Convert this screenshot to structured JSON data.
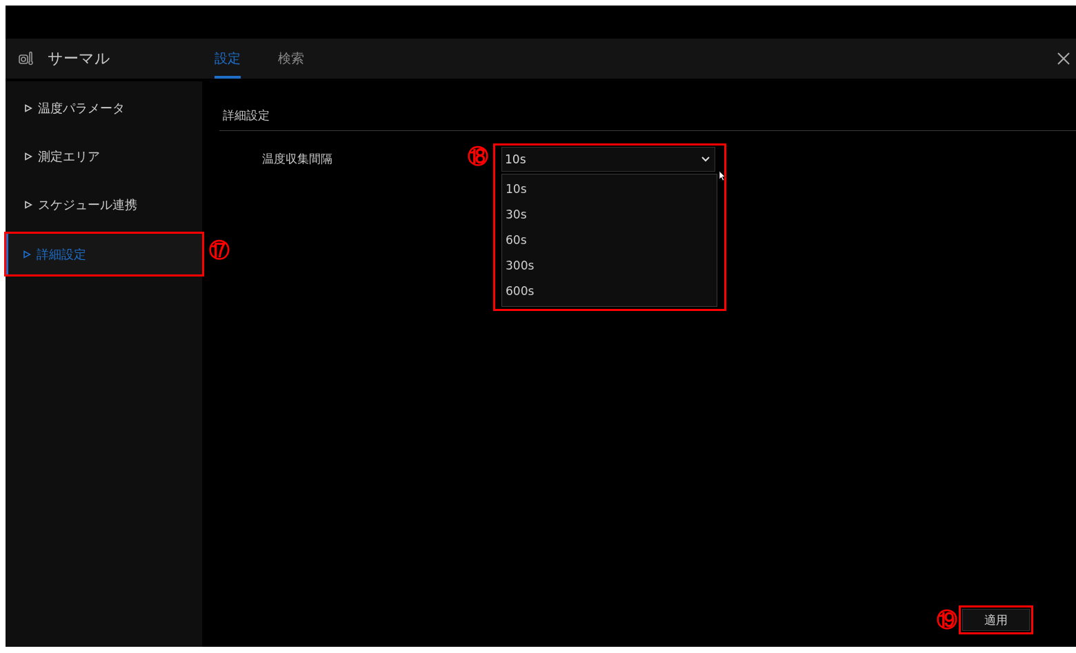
{
  "window": {
    "title": "サーマル"
  },
  "tabs": [
    {
      "label": "設定",
      "selected": true
    },
    {
      "label": "検索",
      "selected": false
    }
  ],
  "sidebar": {
    "items": [
      {
        "label": "温度パラメータ",
        "selected": false
      },
      {
        "label": "測定エリア",
        "selected": false
      },
      {
        "label": "スケジュール連携",
        "selected": false
      },
      {
        "label": "詳細設定",
        "selected": true,
        "annotation": "⑰"
      }
    ]
  },
  "content": {
    "section_title": "詳細設定",
    "fields": [
      {
        "label": "温度収集間隔",
        "value": "10s",
        "expanded": true,
        "annotation": "⑱",
        "options": [
          "10s",
          "30s",
          "60s",
          "300s",
          "600s"
        ]
      }
    ],
    "apply_button": {
      "label": "適用",
      "annotation": "⑲"
    }
  }
}
